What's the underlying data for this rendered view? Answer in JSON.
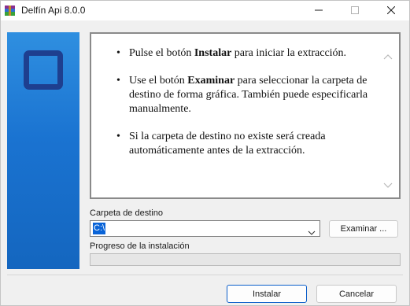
{
  "window": {
    "title": "Delfín Api 8.0.0",
    "icon": "winrar-box-icon"
  },
  "info": {
    "items": [
      {
        "before": "Pulse el botón ",
        "bold": "Instalar",
        "after": " para iniciar la extracción."
      },
      {
        "before": "Use el botón ",
        "bold": "Examinar",
        "after": " para seleccionar la carpeta de destino de forma gráfica. También puede especificarla manualmente."
      },
      {
        "before": "Si la carpeta de destino no existe será creada automáticamente antes de la extracción.",
        "bold": "",
        "after": ""
      }
    ]
  },
  "destination": {
    "label": "Carpeta de destino",
    "value": "C:\\",
    "browse_label": "Examinar ..."
  },
  "progress": {
    "label": "Progreso de la instalación",
    "fraction": 0
  },
  "buttons": {
    "install": "Instalar",
    "cancel": "Cancelar"
  },
  "colors": {
    "accent": "#0a64d8",
    "banner": "#1a73d1",
    "progress": "#06b025"
  }
}
